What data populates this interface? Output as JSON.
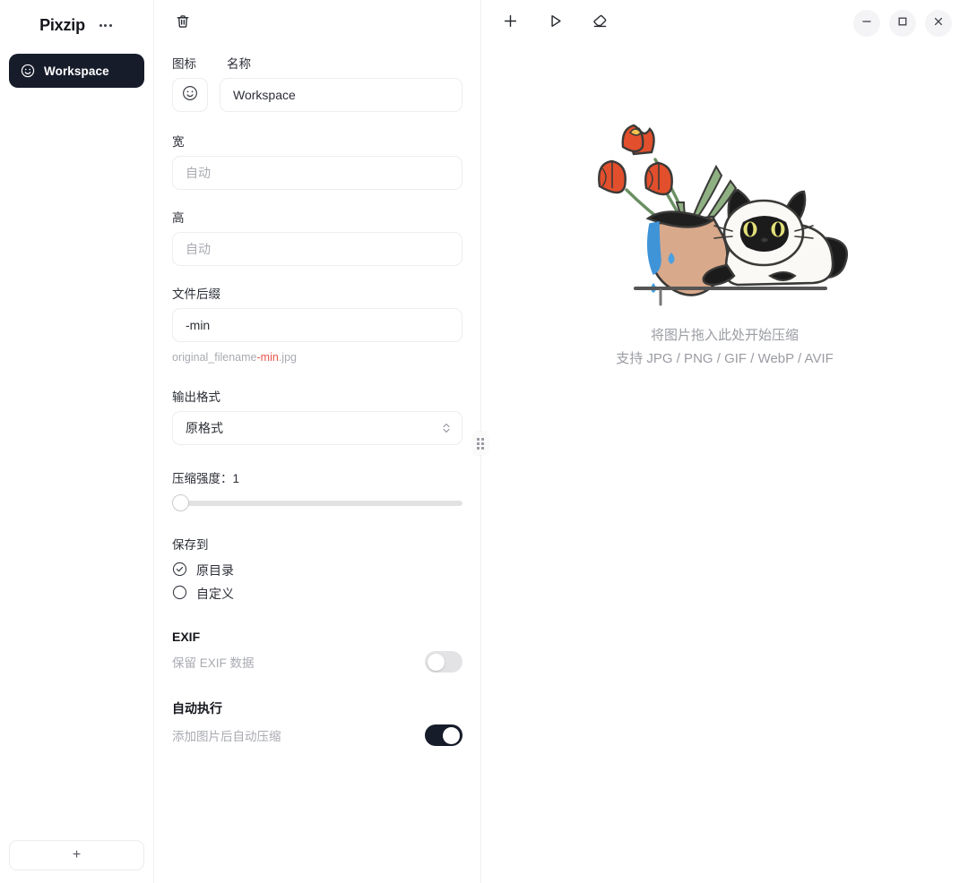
{
  "sidebar": {
    "brand": "Pixzip",
    "more_icon": "more-horizontal-icon",
    "items": [
      {
        "label": "Workspace",
        "icon": "smiley-icon",
        "active": true
      }
    ],
    "add_button_label": "+"
  },
  "settings": {
    "toolbar": {
      "delete_icon": "trash-icon"
    },
    "icon_label": "图标",
    "name_label": "名称",
    "name_value": "Workspace",
    "emoji_icon": "smiley-icon",
    "width": {
      "label": "宽",
      "value": "",
      "placeholder": "自动"
    },
    "height": {
      "label": "高",
      "value": "",
      "placeholder": "自动"
    },
    "suffix": {
      "label": "文件后缀",
      "value": "-min",
      "placeholder": "-min",
      "preview_prefix": "original_filename",
      "preview_accent": "-min",
      "preview_ext": ".jpg"
    },
    "output_format": {
      "label": "输出格式",
      "value": "原格式",
      "options": [
        "原格式"
      ]
    },
    "compression": {
      "label": "压缩强度：",
      "value": "1",
      "min": 1,
      "max": 10,
      "percent": 0
    },
    "save_to": {
      "label": "保存到",
      "options": [
        {
          "label": "原目录",
          "selected": true
        },
        {
          "label": "自定义",
          "selected": false
        }
      ]
    },
    "exif": {
      "title": "EXIF",
      "toggle_label": "保留 EXIF 数据",
      "enabled": false
    },
    "auto_run": {
      "title": "自动执行",
      "toggle_label": "添加图片后自动压缩",
      "enabled": true
    },
    "resize_handle": "drag-handle-icon"
  },
  "main": {
    "toolbar": [
      {
        "name": "add-images-button",
        "icon": "plus-icon"
      },
      {
        "name": "start-compress-button",
        "icon": "play-icon"
      },
      {
        "name": "clear-list-button",
        "icon": "eraser-icon"
      }
    ],
    "window_controls": [
      {
        "name": "minimize-button",
        "icon": "minimize-icon"
      },
      {
        "name": "maximize-button",
        "icon": "maximize-icon"
      },
      {
        "name": "close-button",
        "icon": "close-icon"
      }
    ],
    "dropzone": {
      "illustration": "cat-knocking-vase-illustration",
      "primary_text": "将图片拖入此处开始压缩",
      "secondary_text": "支持 JPG / PNG / GIF / WebP / AVIF"
    }
  },
  "colors": {
    "accent_dark": "#171c2b",
    "suffix_accent": "#e8554b",
    "muted_text": "#a9abb1",
    "border": "#ededef"
  }
}
